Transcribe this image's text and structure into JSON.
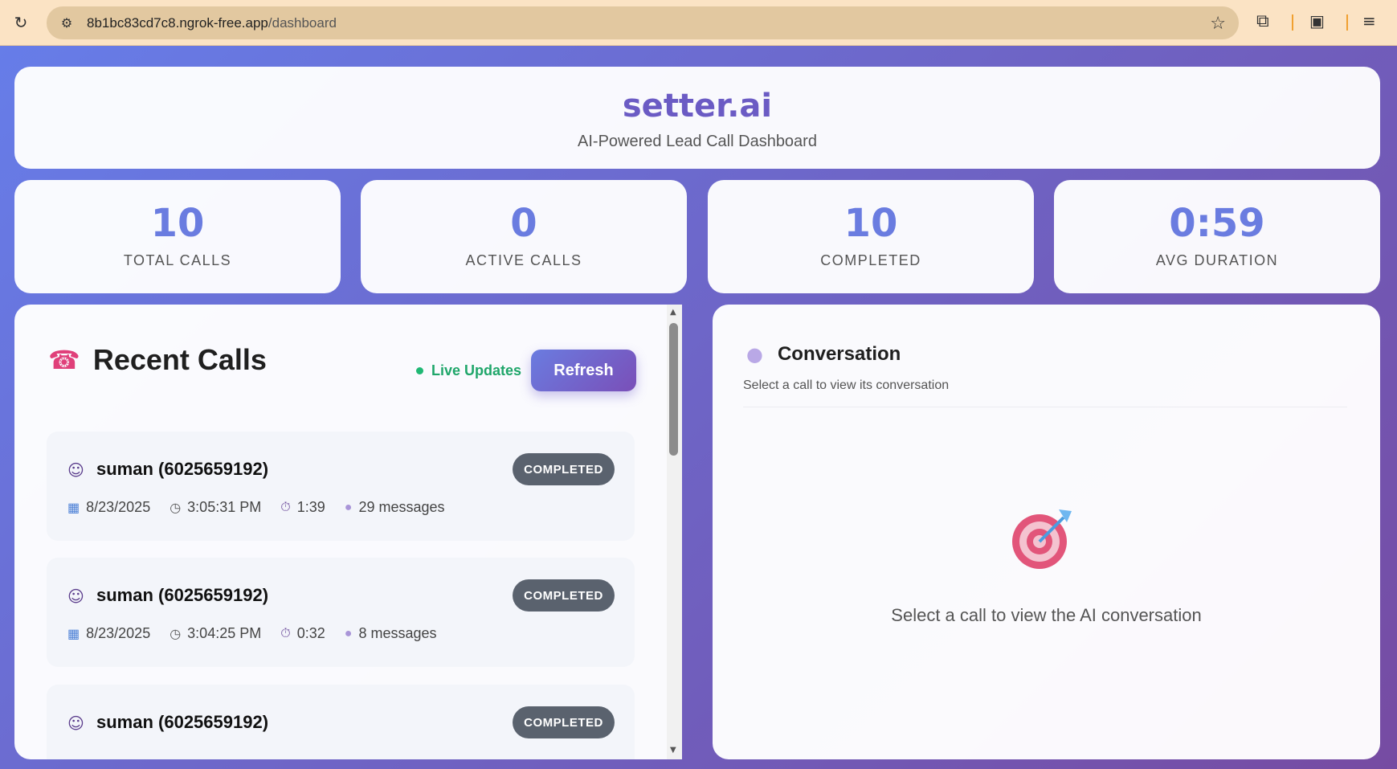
{
  "browser": {
    "url_domain": "8b1bc83cd7c8.ngrok-free.app",
    "url_path": "/dashboard"
  },
  "header": {
    "title": "setter.ai",
    "subtitle": "AI-Powered Lead Call Dashboard"
  },
  "stats": [
    {
      "value": "10",
      "label": "TOTAL CALLS"
    },
    {
      "value": "0",
      "label": "ACTIVE CALLS"
    },
    {
      "value": "10",
      "label": "COMPLETED"
    },
    {
      "value": "0:59",
      "label": "AVG DURATION"
    }
  ],
  "calls_panel": {
    "title": "Recent Calls",
    "live_label": "Live Updates",
    "refresh_label": "Refresh",
    "calls": [
      {
        "name": "suman (6025659192)",
        "status": "COMPLETED",
        "date": "8/23/2025",
        "time": "3:05:31 PM",
        "duration": "1:39",
        "messages": "29 messages"
      },
      {
        "name": "suman (6025659192)",
        "status": "COMPLETED",
        "date": "8/23/2025",
        "time": "3:04:25 PM",
        "duration": "0:32",
        "messages": "8 messages"
      },
      {
        "name": "suman (6025659192)",
        "status": "COMPLETED",
        "date": "",
        "time": "",
        "duration": "",
        "messages": ""
      }
    ]
  },
  "conversation": {
    "title": "Conversation",
    "subtitle": "Select a call to view its conversation",
    "empty_message": "Select a call to view the AI conversation"
  },
  "colors": {
    "brand": "#6b5bc4",
    "stat_value": "#6a7ce0",
    "live": "#1fa66a",
    "badge": "#5a626e"
  },
  "icons": [
    "reload-icon",
    "site-info-icon",
    "star-icon",
    "extensions-icon",
    "reader-icon",
    "media-icon",
    "phone-icon",
    "user-icon",
    "calendar-icon",
    "clock-icon",
    "timer-icon",
    "message-icon",
    "speech-bubble-icon",
    "target-icon"
  ]
}
